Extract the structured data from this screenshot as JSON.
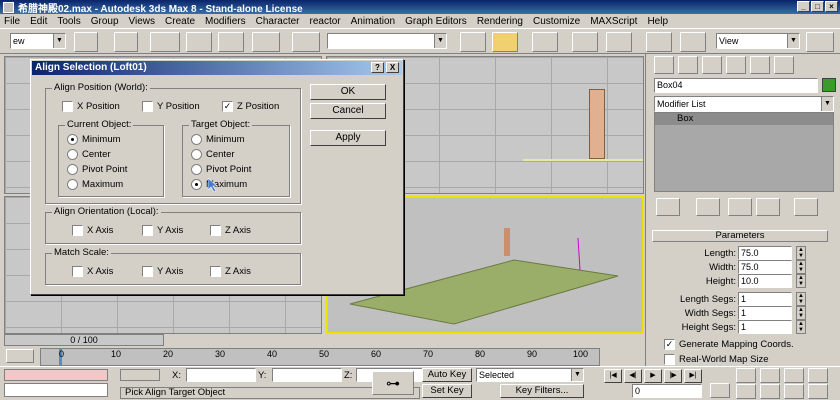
{
  "window": {
    "title": "希腊神殿02.max - Autodesk 3ds Max 8 - Stand-alone License"
  },
  "menu": [
    "File",
    "Edit",
    "Tools",
    "Group",
    "Views",
    "Create",
    "Modifiers",
    "Character",
    "reactor",
    "Animation",
    "Graph Editors",
    "Rendering",
    "Customize",
    "MAXScript",
    "Help"
  ],
  "toolbar": {
    "filter_value": "ew",
    "view_value": "View"
  },
  "dialog": {
    "title": "Align Selection (Loft01)",
    "help_btn": "?",
    "close_btn": "X",
    "ok": "OK",
    "cancel": "Cancel",
    "apply": "Apply",
    "align_position_title": "Align Position (World):",
    "x_position": "X Position",
    "y_position": "Y Position",
    "z_position": "Z Position",
    "current_object_title": "Current Object:",
    "target_object_title": "Target Object:",
    "opt_minimum": "Minimum",
    "opt_center": "Center",
    "opt_pivot": "Pivot Point",
    "opt_maximum": "Maximum",
    "align_orientation_title": "Align Orientation (Local):",
    "x_axis": "X Axis",
    "y_axis": "Y Axis",
    "z_axis": "Z Axis",
    "match_scale_title": "Match Scale:",
    "check_mark": "✓"
  },
  "command_panel": {
    "object_name": "Box04",
    "modifier_list": "Modifier List",
    "stack_item": "Box",
    "parameters_title": "Parameters",
    "length_label": "Length:",
    "length_value": "75.0",
    "width_label": "Width:",
    "width_value": "75.0",
    "height_label": "Height:",
    "height_value": "10.0",
    "length_segs_label": "Length Segs:",
    "length_segs_value": "1",
    "width_segs_label": "Width Segs:",
    "width_segs_value": "1",
    "height_segs_label": "Height Segs:",
    "height_segs_value": "1",
    "gen_mapping": "Generate Mapping Coords.",
    "real_world": "Real-World Map Size"
  },
  "timeline": {
    "slider_label": "0 / 100",
    "ticks": [
      "0",
      "10",
      "20",
      "30",
      "40",
      "50",
      "60",
      "70",
      "80",
      "90",
      "100"
    ]
  },
  "status": {
    "prompt": "Pick Align Target Object",
    "x_label": "X:",
    "y_label": "Y:",
    "z_label": "Z:",
    "auto_key": "Auto Key",
    "set_key": "Set Key",
    "selected": "Selected",
    "key_filters": "Key Filters...",
    "frame_value": "0"
  }
}
